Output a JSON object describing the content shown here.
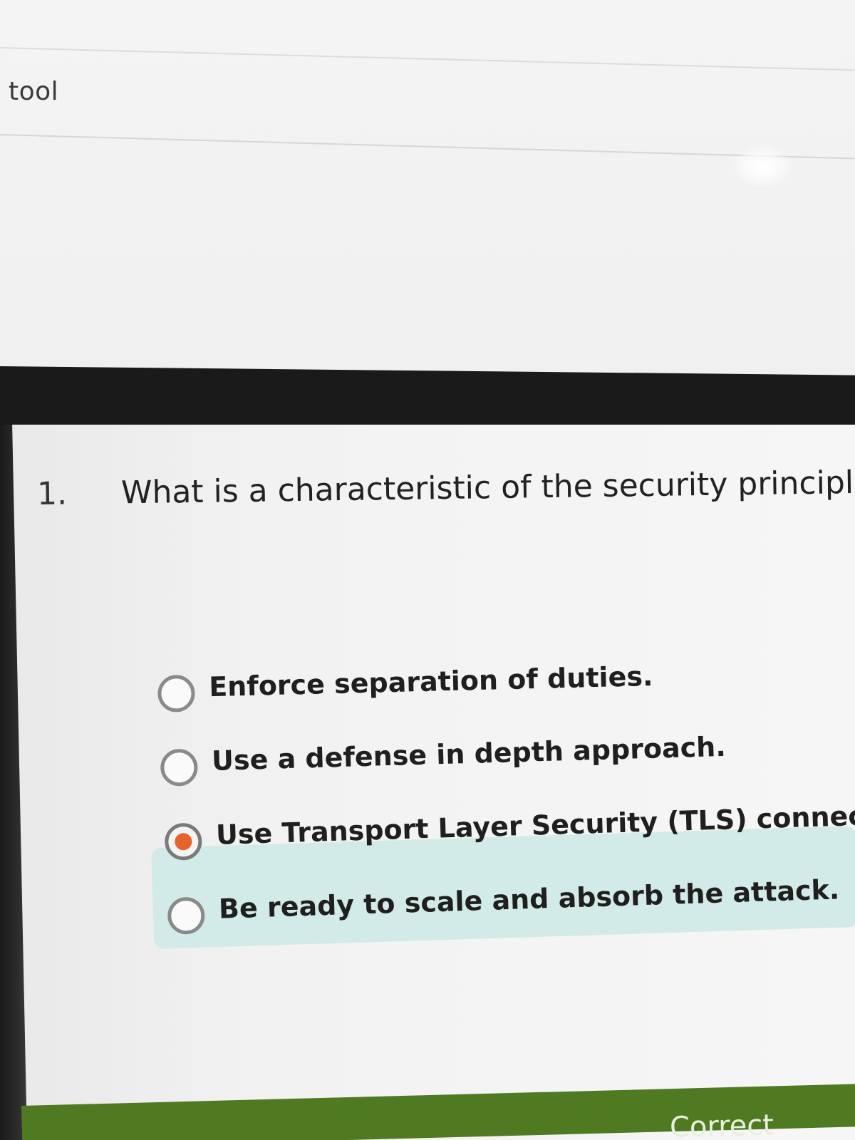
{
  "header": {
    "tool_label": "tool"
  },
  "question": {
    "number": "1.",
    "text": "What is a characteristic of the security principle"
  },
  "options": [
    {
      "label": "Enforce separation of duties.",
      "selected": false
    },
    {
      "label": "Use a defense in depth approach.",
      "selected": false
    },
    {
      "label": "Use Transport Layer Security (TLS) connections.",
      "selected": true
    },
    {
      "label": "Be ready to scale and absorb the attack.",
      "selected": false,
      "highlighted": true
    }
  ],
  "footer": {
    "status_text": "Correct"
  },
  "colors": {
    "selected_radio": "#e8622b",
    "correct_highlight": "#d3ebe8",
    "correct_bar": "#4f7a22",
    "dark_band": "#1a1a1a"
  }
}
